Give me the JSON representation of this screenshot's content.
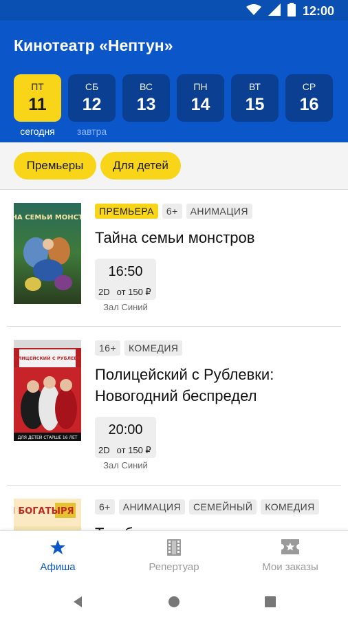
{
  "status": {
    "time": "12:00"
  },
  "header": {
    "title": "Кинотеатр «Нептун»"
  },
  "dates": [
    {
      "dow": "ПТ",
      "num": "11",
      "caption": "сегодня"
    },
    {
      "dow": "СБ",
      "num": "12",
      "caption": "завтра"
    },
    {
      "dow": "ВС",
      "num": "13",
      "caption": ""
    },
    {
      "dow": "ПН",
      "num": "14",
      "caption": ""
    },
    {
      "dow": "ВТ",
      "num": "15",
      "caption": ""
    },
    {
      "dow": "СР",
      "num": "16",
      "caption": ""
    }
  ],
  "filters": [
    "Премьеры",
    "Для детей"
  ],
  "movies": [
    {
      "title": "Тайна семьи монстров",
      "tags": [
        "ПРЕМЬЕРА",
        "6+",
        "АНИМАЦИЯ"
      ],
      "session": {
        "time": "16:50",
        "format": "2D",
        "price": "от 150 ₽",
        "hall": "Зал Синий"
      },
      "poster": {
        "text": "ТАЙНА СЕМЬИ МОНСТРОВ"
      }
    },
    {
      "title": "Полицейский с Рублевки: Новогодний беспредел",
      "tags": [
        "16+",
        "КОМЕДИЯ"
      ],
      "session": {
        "time": "20:00",
        "format": "2D",
        "price": "от 150 ₽",
        "hall": "Зал Синий"
      },
      "poster": {
        "text": "ПОЛИЦЕЙСКИЙ С РУБЛЕВКИ",
        "footer": "ДЛЯ ДЕТЕЙ СТАРШЕ 16 ЛЕТ"
      }
    },
    {
      "title": "Три богатыря и наследница",
      "tags": [
        "6+",
        "АНИМАЦИЯ",
        "СЕМЕЙНЫЙ",
        "КОМЕДИЯ"
      ],
      "poster": {
        "text": "ТРИ БОГАТЫРЯ"
      }
    }
  ],
  "nav": {
    "items": [
      "Афиша",
      "Репертуар",
      "Мои заказы"
    ]
  },
  "colors": {
    "primary": "#0b57c9",
    "accent": "#f9d51a",
    "dark_day": "#0b3f92"
  }
}
